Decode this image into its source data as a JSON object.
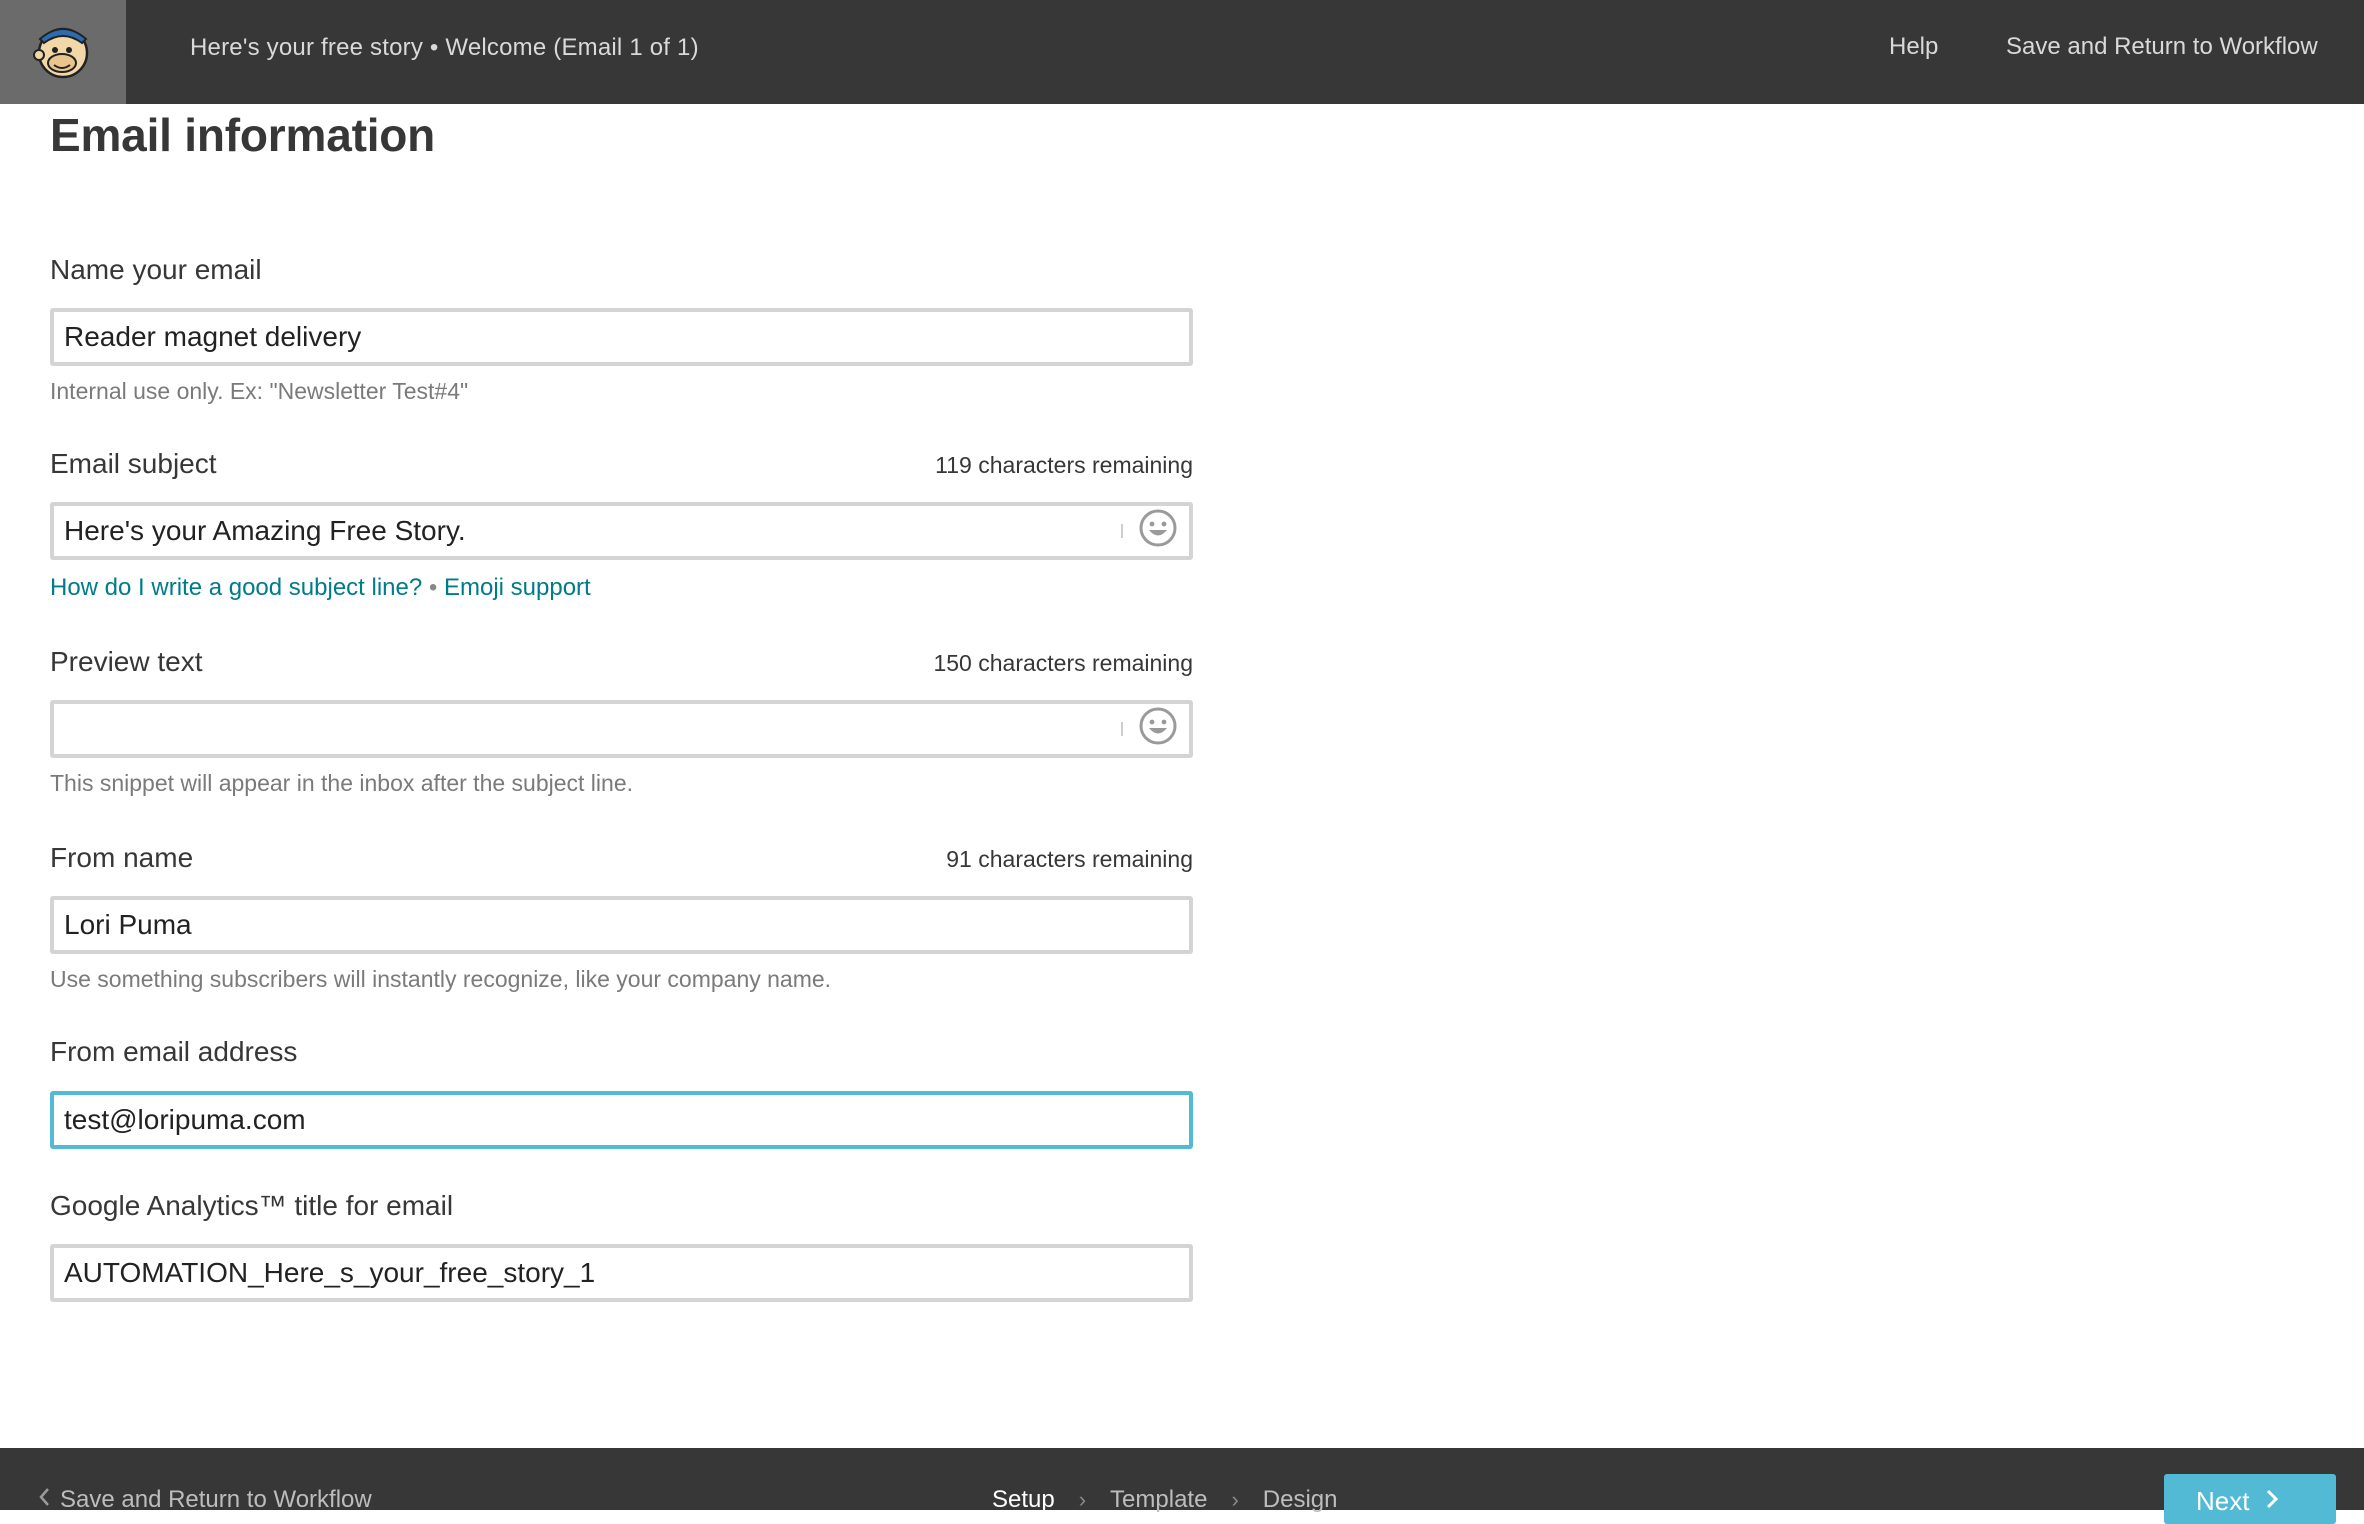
{
  "header": {
    "title": "Here's your free story • Welcome (Email 1 of 1)",
    "help_label": "Help",
    "save_label": "Save and Return to Workflow",
    "logo_icon": "mailchimp-logo-icon"
  },
  "main": {
    "page_title": "Email information",
    "fields": {
      "name": {
        "label": "Name your email",
        "value": "Reader magnet delivery",
        "help": "Internal use only. Ex: \"Newsletter Test#4\""
      },
      "subject": {
        "label": "Email subject",
        "counter": "119 characters remaining",
        "value": "Here's your Amazing Free Story.",
        "link_subject": "How do I write a good subject line?",
        "link_separator": "•",
        "link_emoji": "Emoji support"
      },
      "preview": {
        "label": "Preview text",
        "counter": "150 characters remaining",
        "value": "",
        "help": "This snippet will appear in the inbox after the subject line."
      },
      "from_name": {
        "label": "From name",
        "counter": "91 characters remaining",
        "value": "Lori Puma",
        "help": "Use something subscribers will instantly recognize, like your company name."
      },
      "from_email": {
        "label": "From email address",
        "value": "test@loripuma.com"
      },
      "ga_title": {
        "label": "Google Analytics™ title for email",
        "value": "AUTOMATION_Here_s_your_free_story_1"
      }
    }
  },
  "footer": {
    "back_label": "Save and Return to Workflow",
    "steps": [
      "Setup",
      "Template",
      "Design"
    ],
    "active_step": "Setup",
    "next_label": "Next"
  },
  "colors": {
    "topbar": "#373737",
    "accent": "#52bad5",
    "link": "#007c89"
  }
}
